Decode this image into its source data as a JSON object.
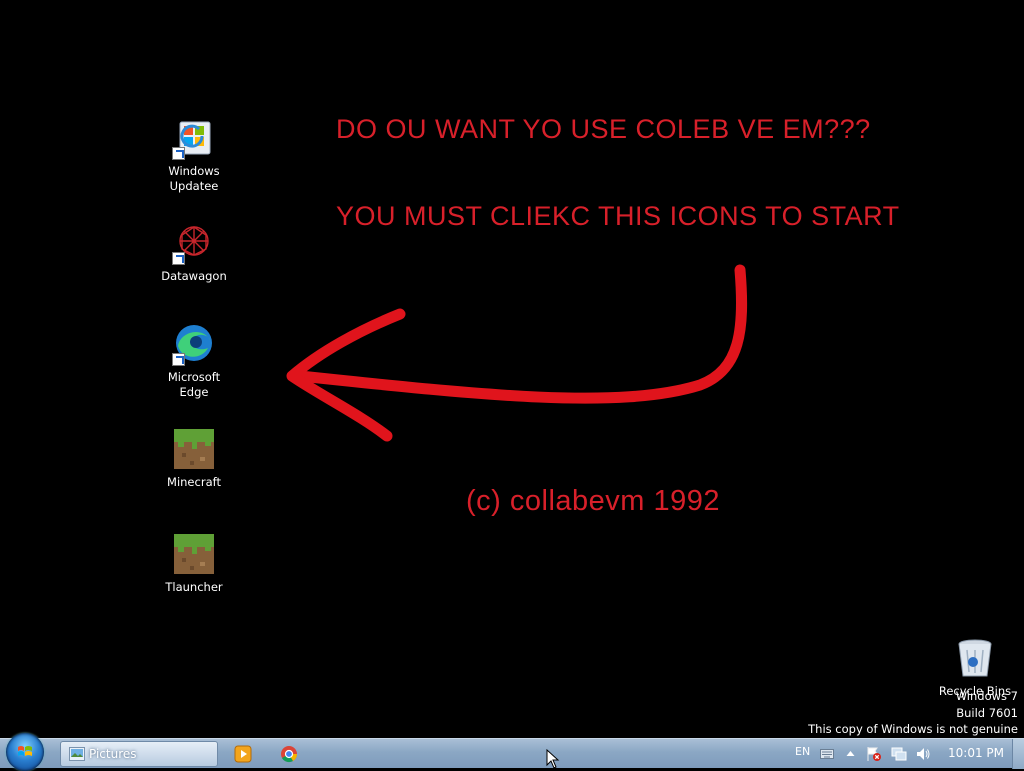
{
  "desktop": {
    "wallpaper_text": {
      "line1": "DO OU WANT YO USE COLEB VE EM???",
      "line2": "YOU MUST CLIEKC THIS ICONS TO START",
      "copyright": "(c) collabevm 1992"
    },
    "wallpaper_color": "#000000",
    "text_color": "#d8202a",
    "icons": [
      {
        "name": "Windows Updatee",
        "label_line1": "Windows",
        "label_line2": "Updatee",
        "icon": "windows-update-icon"
      },
      {
        "name": "Datawagon",
        "label_line1": "Datawagon",
        "label_line2": "",
        "icon": "datawagon-icon"
      },
      {
        "name": "Microsoft Edge",
        "label_line1": "Microsoft",
        "label_line2": "Edge",
        "icon": "edge-icon"
      },
      {
        "name": "Minecraft",
        "label_line1": "Minecraft",
        "label_line2": "",
        "icon": "minecraft-grass-block-icon"
      },
      {
        "name": "Tlauncher",
        "label_line1": "Tlauncher",
        "label_line2": "",
        "icon": "minecraft-grass-block-icon"
      }
    ],
    "recycle_bin": {
      "label": "Recycle Bins",
      "icon": "recycle-bin-icon"
    },
    "watermark": {
      "line1": "Windows 7",
      "line2": "Build 7601",
      "line3": "This copy of Windows is not genuine"
    }
  },
  "taskbar": {
    "start_button": "start-orb-icon",
    "open_window": {
      "label": "Pictures",
      "icon": "pictures-folder-icon"
    },
    "pinned": [
      "windows-media-player-icon",
      "chrome-icon"
    ],
    "tray": {
      "language": "EN",
      "clock": "10:01 PM"
    }
  }
}
